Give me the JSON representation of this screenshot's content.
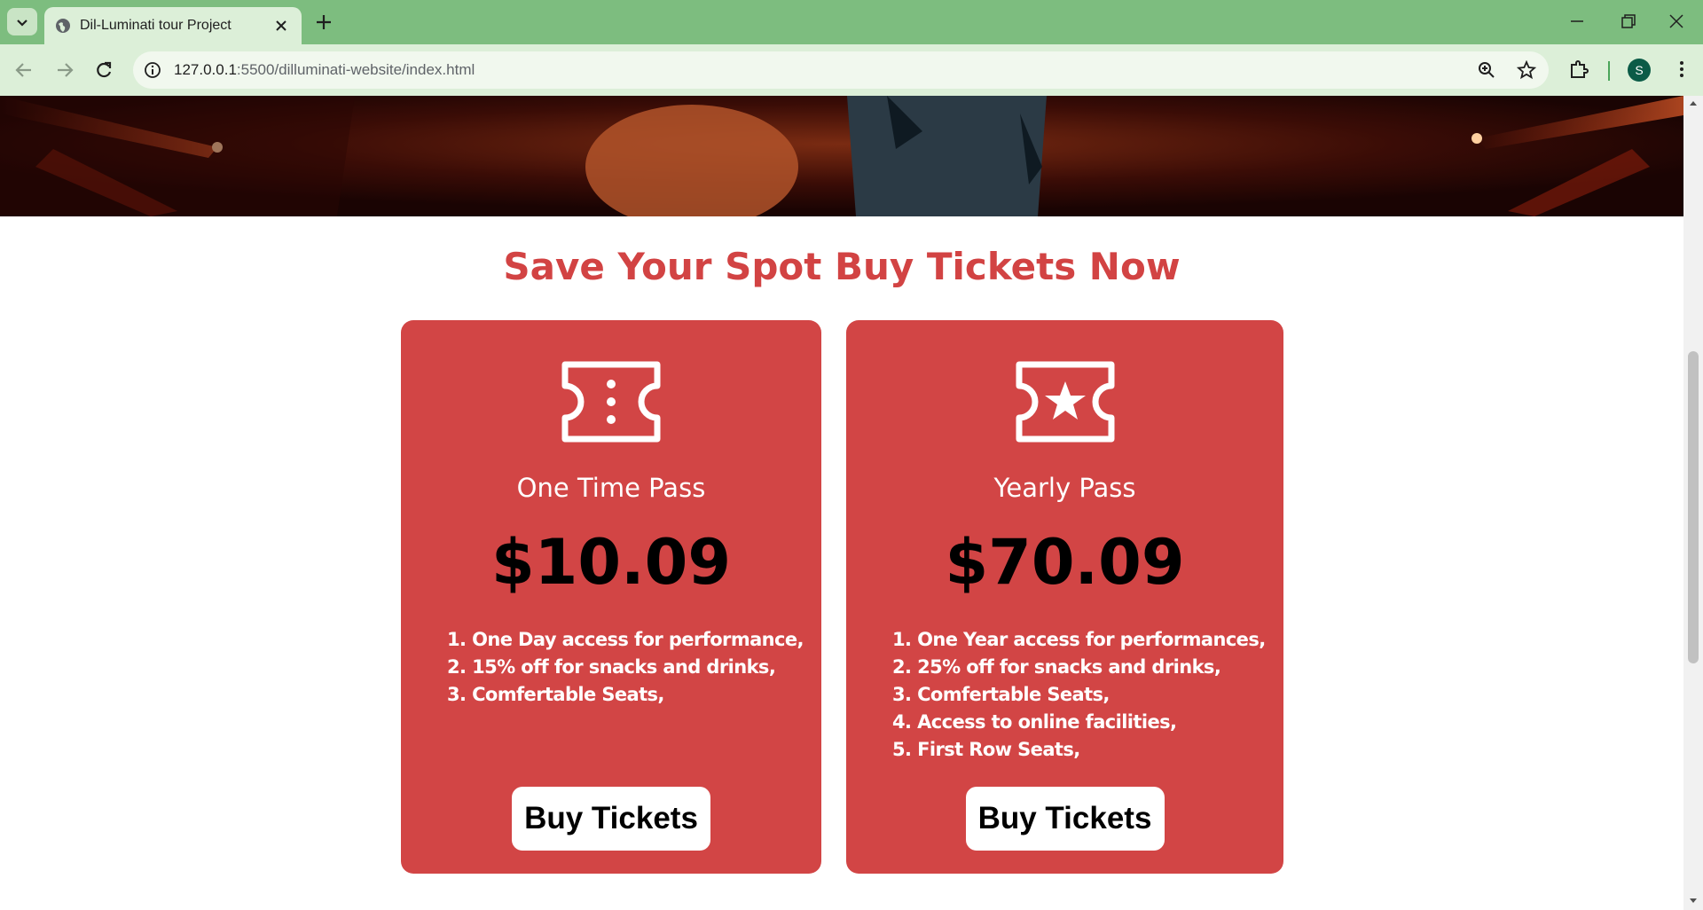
{
  "browser": {
    "tab_title": "Dil-Luminati tour Project",
    "url_host": "127.0.0.1",
    "url_rest": ":5500/dilluminati-website/index.html",
    "profile_initial": "S"
  },
  "page": {
    "section_title": "Save Your Spot Buy Tickets Now",
    "cards": [
      {
        "icon": "ticket-icon",
        "name": "One Time Pass",
        "price": "$10.09",
        "features": [
          "1. One Day access for performance,",
          "2. 15% off for snacks and drinks,",
          "3. Comfertable Seats,"
        ],
        "button_label": "Buy Tickets"
      },
      {
        "icon": "ticket-star-icon",
        "name": "Yearly Pass",
        "price": "$70.09",
        "features": [
          "1. One Year access for performances,",
          "2. 25% off for snacks and drinks,",
          "3. Comfertable Seats,",
          "4. Access to online facilities,",
          "5. First Row Seats,"
        ],
        "button_label": "Buy Tickets"
      }
    ]
  },
  "colors": {
    "accent_red": "#d24545",
    "tabbar_green": "#7dbd7f",
    "toolbar_green": "#dcefd8"
  }
}
